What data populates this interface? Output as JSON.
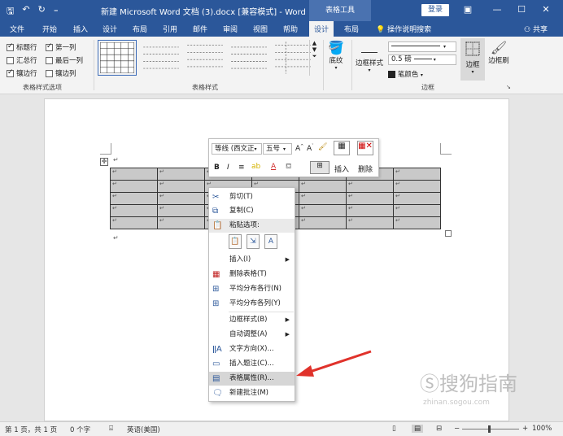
{
  "titlebar": {
    "doc_title": "新建 Microsoft Word 文档 (3).docx [兼容模式] - Word",
    "tools_tab": "表格工具",
    "login": "登录"
  },
  "tabs": [
    "文件",
    "开始",
    "插入",
    "设计",
    "布局",
    "引用",
    "邮件",
    "审阅",
    "视图",
    "帮助",
    "设计",
    "布局"
  ],
  "active_tab_index": 10,
  "tell_me": "操作说明搜索",
  "share": "共享",
  "ribbon": {
    "style_options": {
      "items": [
        {
          "label": "标题行",
          "checked": true
        },
        {
          "label": "第一列",
          "checked": true
        },
        {
          "label": "汇总行",
          "checked": false
        },
        {
          "label": "最后一列",
          "checked": false
        },
        {
          "label": "镶边行",
          "checked": true
        },
        {
          "label": "镶边列",
          "checked": false
        }
      ],
      "group_label": "表格样式选项"
    },
    "table_styles_label": "表格样式",
    "shading": "底纹",
    "border_styles": "边框样式",
    "pen_weight": "0.5 磅",
    "pen_color": "笔颜色",
    "borders": "边框",
    "border_painter": "边框刷",
    "borders_group_label": "边框"
  },
  "mini_toolbar": {
    "font": "等线 (西文正",
    "size": "五号",
    "insert": "插入",
    "delete": "删除"
  },
  "context_menu": {
    "items": [
      {
        "label": "剪切(T)",
        "icon": "scissors-icon"
      },
      {
        "label": "复制(C)",
        "icon": "copy-icon"
      },
      {
        "label": "粘贴选项:",
        "icon": "paste-icon"
      },
      {
        "label": "插入(I)",
        "icon": "",
        "submenu": true
      },
      {
        "label": "删除表格(T)",
        "icon": "delete-table-icon"
      },
      {
        "label": "平均分布各行(N)",
        "icon": "distribute-rows-icon"
      },
      {
        "label": "平均分布各列(Y)",
        "icon": "distribute-columns-icon"
      },
      {
        "label": "边框样式(B)",
        "icon": "",
        "submenu": true
      },
      {
        "label": "自动调整(A)",
        "icon": "",
        "submenu": true
      },
      {
        "label": "文字方向(X)...",
        "icon": "text-direction-icon"
      },
      {
        "label": "插入题注(C)...",
        "icon": "caption-icon"
      },
      {
        "label": "表格属性(R)...",
        "icon": "table-properties-icon",
        "highlighted": true
      },
      {
        "label": "新建批注(M)",
        "icon": "comment-icon"
      }
    ]
  },
  "statusbar": {
    "pages": "第 1 页，共 1 页",
    "words": "0 个字",
    "language": "英语(美国)",
    "zoom": "100%"
  },
  "watermark": {
    "main": "搜狗指南",
    "sub": "zhinan.sogou.com"
  },
  "colors": {
    "title_blue": "#2b579a",
    "annotation_red": "#e0322b"
  }
}
